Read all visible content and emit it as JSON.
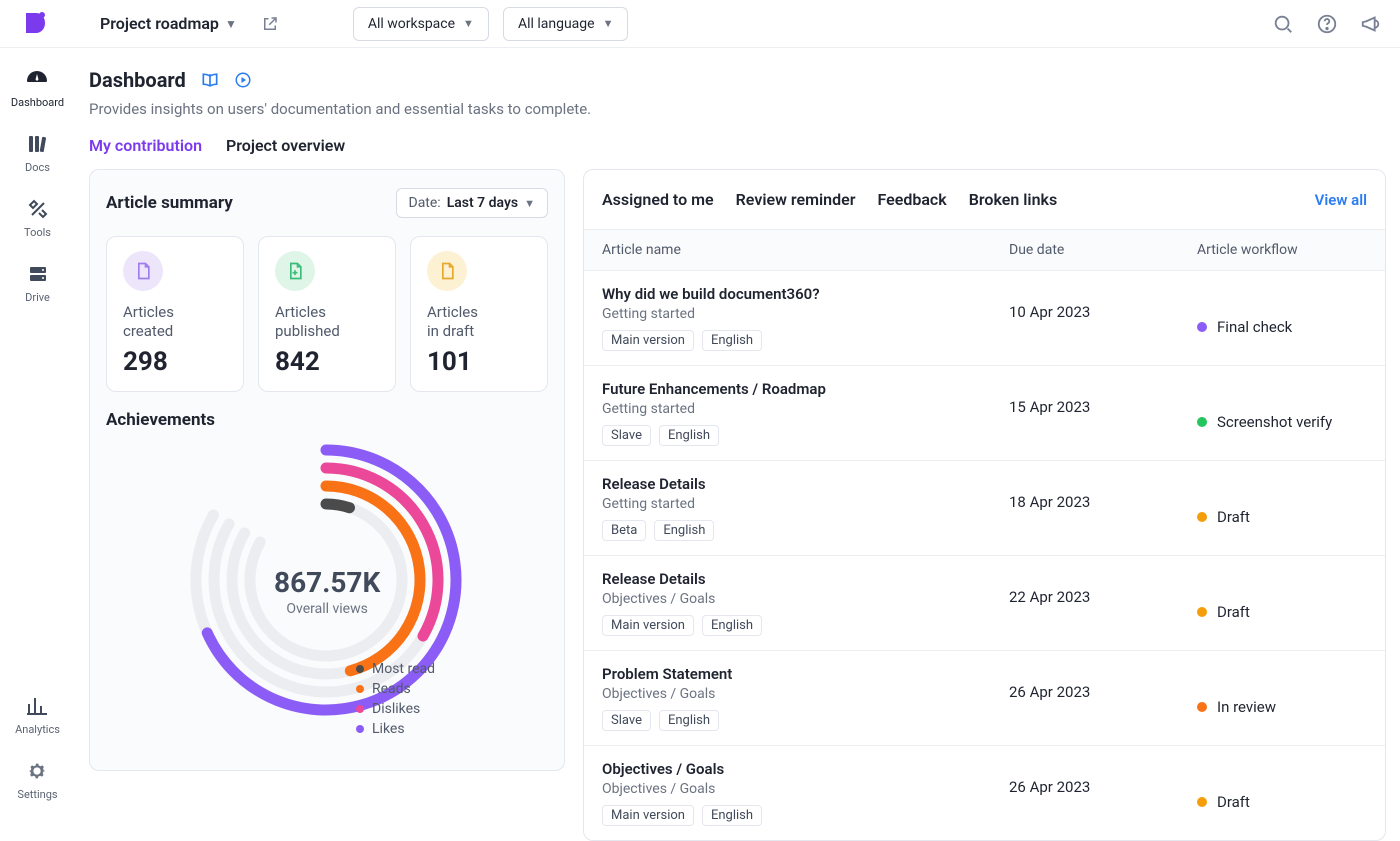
{
  "header": {
    "project": "Project roadmap",
    "workspace_filter": "All workspace",
    "language_filter": "All language"
  },
  "rail": {
    "items": [
      {
        "id": "dashboard",
        "label": "Dashboard"
      },
      {
        "id": "docs",
        "label": "Docs"
      },
      {
        "id": "tools",
        "label": "Tools"
      },
      {
        "id": "drive",
        "label": "Drive"
      }
    ],
    "bottom": [
      {
        "id": "analytics",
        "label": "Analytics"
      },
      {
        "id": "settings",
        "label": "Settings"
      }
    ]
  },
  "page": {
    "title": "Dashboard",
    "subtitle": "Provides insights on users' documentation and essential tasks to complete.",
    "view_tabs": [
      "My contribution",
      "Project overview"
    ]
  },
  "summary": {
    "title": "Article summary",
    "date_label": "Date:",
    "date_value": "Last 7 days",
    "stats": [
      {
        "label_line1": "Articles",
        "label_line2": "created",
        "value": "298"
      },
      {
        "label_line1": "Articles",
        "label_line2": "published",
        "value": "842"
      },
      {
        "label_line1": "Articles",
        "label_line2": "in draft",
        "value": "101"
      }
    ],
    "achievements_title": "Achievements",
    "overall_number": "867.57K",
    "overall_label": "Overall views",
    "legend": [
      {
        "label": "Most read",
        "color": "#4b4b4b"
      },
      {
        "label": "Reads",
        "color": "#f97316"
      },
      {
        "label": "Dislikes",
        "color": "#ec4899"
      },
      {
        "label": "Likes",
        "color": "#8b5cf6"
      }
    ]
  },
  "tasks": {
    "tabs": [
      "Assigned to me",
      "Review reminder",
      "Feedback",
      "Broken links"
    ],
    "view_all": "View all",
    "columns": [
      "Article name",
      "Due date",
      "Article workflow"
    ],
    "rows": [
      {
        "name": "Why did we build document360?",
        "category": "Getting started",
        "tags": [
          "Main version",
          "English"
        ],
        "date": "10 Apr 2023",
        "workflow": "Final check",
        "wf_color": "c-purple"
      },
      {
        "name": "Future Enhancements / Roadmap",
        "category": "Getting started",
        "tags": [
          "Slave",
          "English"
        ],
        "date": "15 Apr 2023",
        "workflow": "Screenshot verify",
        "wf_color": "c-green-b"
      },
      {
        "name": "Release Details",
        "category": "Getting started",
        "tags": [
          "Beta",
          "English"
        ],
        "date": "18 Apr 2023",
        "workflow": "Draft",
        "wf_color": "c-amber"
      },
      {
        "name": "Release Details",
        "category": "Objectives / Goals",
        "tags": [
          "Main version",
          "English"
        ],
        "date": "22 Apr 2023",
        "workflow": "Draft",
        "wf_color": "c-amber"
      },
      {
        "name": "Problem Statement",
        "category": "Objectives / Goals",
        "tags": [
          "Slave",
          "English"
        ],
        "date": "26 Apr 2023",
        "workflow": "In review",
        "wf_color": "c-orange"
      },
      {
        "name": "Objectives / Goals",
        "category": "Objectives / Goals",
        "tags": [
          "Main version",
          "English"
        ],
        "date": "26 Apr 2023",
        "workflow": "Draft",
        "wf_color": "c-amber"
      }
    ]
  },
  "chart_data": {
    "type": "radial",
    "title": "Achievements",
    "center_value": "867.57K",
    "center_label": "Overall views",
    "series": [
      {
        "name": "Most read",
        "color": "#4b4b4b",
        "fraction": 0.06
      },
      {
        "name": "Reads",
        "color": "#f97316",
        "fraction": 0.55
      },
      {
        "name": "Dislikes",
        "color": "#ec4899",
        "fraction": 0.4
      },
      {
        "name": "Likes",
        "color": "#8b5cf6",
        "fraction": 0.82
      }
    ]
  }
}
